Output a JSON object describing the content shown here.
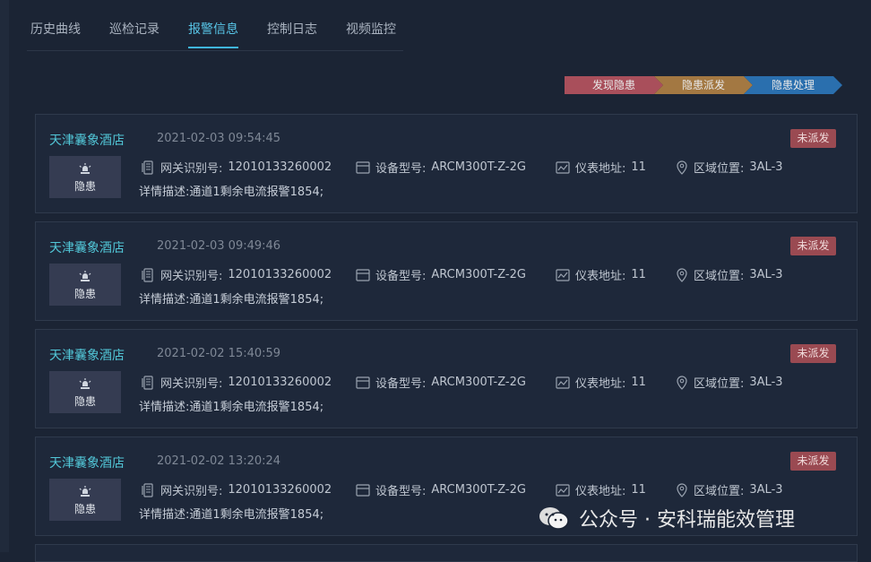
{
  "tabs": [
    {
      "label": "历史曲线",
      "active": false
    },
    {
      "label": "巡检记录",
      "active": false
    },
    {
      "label": "报警信息",
      "active": true
    },
    {
      "label": "控制日志",
      "active": false
    },
    {
      "label": "视频监控",
      "active": false
    }
  ],
  "steps": [
    "发现隐患",
    "隐患派发",
    "隐患处理"
  ],
  "labels": {
    "gateway": "网关识别号:",
    "model": "设备型号:",
    "address": "仪表地址:",
    "area": "区域位置:",
    "hazard": "隐患"
  },
  "alarms": [
    {
      "name": "天津囊象酒店",
      "time": "2021-02-03 09:54:45",
      "status": "未派发",
      "gateway_id": "12010133260002",
      "model": "ARCM300T-Z-2G",
      "address": "11",
      "area": "3AL-3",
      "detail": "详情描述:通道1剩余电流报警1854;"
    },
    {
      "name": "天津囊象酒店",
      "time": "2021-02-03 09:49:46",
      "status": "未派发",
      "gateway_id": "12010133260002",
      "model": "ARCM300T-Z-2G",
      "address": "11",
      "area": "3AL-3",
      "detail": "详情描述:通道1剩余电流报警1854;"
    },
    {
      "name": "天津囊象酒店",
      "time": "2021-02-02 15:40:59",
      "status": "未派发",
      "gateway_id": "12010133260002",
      "model": "ARCM300T-Z-2G",
      "address": "11",
      "area": "3AL-3",
      "detail": "详情描述:通道1剩余电流报警1854;"
    },
    {
      "name": "天津囊象酒店",
      "time": "2021-02-02 13:20:24",
      "status": "未派发",
      "gateway_id": "12010133260002",
      "model": "ARCM300T-Z-2G",
      "address": "11",
      "area": "3AL-3",
      "detail": "详情描述:通道1剩余电流报警1854;"
    }
  ],
  "watermark": "公众号 · 安科瑞能效管理",
  "colors": {
    "accent": "#3fb6de",
    "badge": "#9a4a52",
    "step1": "#a94f5b",
    "step2": "#a37842",
    "step3": "#2a6fae"
  }
}
